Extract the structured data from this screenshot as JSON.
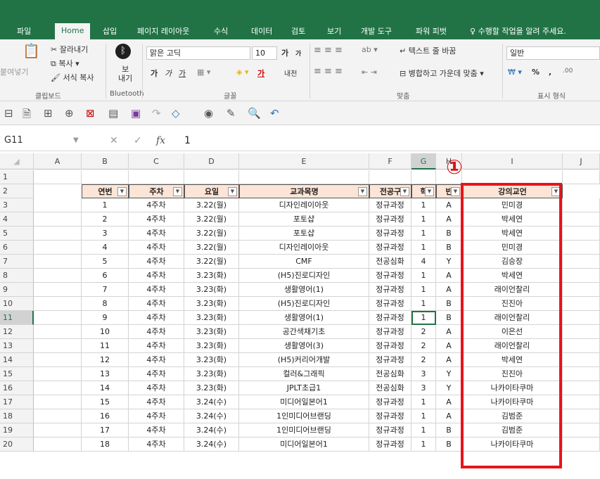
{
  "tabs": [
    "파일",
    "Home",
    "삽입",
    "페이지 레이아웃",
    "수식",
    "데이터",
    "검토",
    "보기",
    "개발 도구",
    "파워 피벗",
    "수행할 작업을 알려 주세요."
  ],
  "ribbon": {
    "clipboard": {
      "paste": "붙여넣기",
      "cut": "잘라내기",
      "copy": "복사 ▾",
      "format": "서식 복사",
      "group": "클립보드"
    },
    "bluetooth": {
      "send": "보\n내기",
      "group": "Bluetooth"
    },
    "font": {
      "name": "맑은 고딕",
      "size": "10",
      "grow": "가",
      "shrink": "가",
      "bold": "가",
      "italic": "가",
      "underline": "가",
      "fontcolor": "가",
      "phonetic": "내천",
      "group": "글꼴"
    },
    "align": {
      "wrap": "텍스트 줄 바꿈",
      "merge": "병합하고 가운데 맞춤 ▾",
      "group": "맞춤"
    },
    "number": {
      "format": "일반",
      "percent": "%",
      "comma": ",",
      "group": "표시 형식"
    }
  },
  "formula": {
    "namebox": "G11",
    "value": "1",
    "cancel": "✕",
    "enter": "✓",
    "fx": "fx"
  },
  "columns": [
    "A",
    "B",
    "C",
    "D",
    "E",
    "F",
    "G",
    "H",
    "I",
    "J"
  ],
  "row_numbers": [
    "1",
    "2",
    "3",
    "4",
    "5",
    "6",
    "7",
    "8",
    "9",
    "10",
    "11",
    "12",
    "13",
    "14",
    "15",
    "16",
    "17",
    "18",
    "19",
    "20"
  ],
  "headers": {
    "no": "연번",
    "week": "주차",
    "day": "요일",
    "course": "교과목명",
    "track": "전공구",
    "grade": "학",
    "class": "반",
    "teacher": "강의교언"
  },
  "rows": [
    [
      "1",
      "4주차",
      "3.22(월)",
      "디자인레이아웃",
      "정규과정",
      "1",
      "A",
      "민미경"
    ],
    [
      "2",
      "4주차",
      "3.22(월)",
      "포토샵",
      "정규과정",
      "1",
      "A",
      "박세연"
    ],
    [
      "3",
      "4주차",
      "3.22(월)",
      "포토샵",
      "정규과정",
      "1",
      "B",
      "박세연"
    ],
    [
      "4",
      "4주차",
      "3.22(월)",
      "디자인레이아웃",
      "정규과정",
      "1",
      "B",
      "민미경"
    ],
    [
      "5",
      "4주차",
      "3.22(월)",
      "CMF",
      "전공심화",
      "4",
      "Y",
      "김승장"
    ],
    [
      "6",
      "4주차",
      "3.23(화)",
      "(H5)진로디자인",
      "정규과정",
      "1",
      "A",
      "박세연"
    ],
    [
      "7",
      "4주차",
      "3.23(화)",
      "생활영어(1)",
      "정규과정",
      "1",
      "A",
      "래이언찰리"
    ],
    [
      "8",
      "4주차",
      "3.23(화)",
      "(H5)진로디자인",
      "정규과정",
      "1",
      "B",
      "진진아"
    ],
    [
      "9",
      "4주차",
      "3.23(화)",
      "생활영어(1)",
      "정규과정",
      "1",
      "B",
      "래이언찰리"
    ],
    [
      "10",
      "4주차",
      "3.23(화)",
      "공간색채기초",
      "정규과정",
      "2",
      "A",
      "이은선"
    ],
    [
      "11",
      "4주차",
      "3.23(화)",
      "생활영어(3)",
      "정규과정",
      "2",
      "A",
      "래이언찰리"
    ],
    [
      "12",
      "4주차",
      "3.23(화)",
      "(H5)커리어개발",
      "정규과정",
      "2",
      "A",
      "박세연"
    ],
    [
      "13",
      "4주차",
      "3.23(화)",
      "컬러&그래픽",
      "전공심화",
      "3",
      "Y",
      "진진아"
    ],
    [
      "14",
      "4주차",
      "3.23(화)",
      "JPLT초급1",
      "전공심화",
      "3",
      "Y",
      "나카이타쿠마"
    ],
    [
      "15",
      "4주차",
      "3.24(수)",
      "미디어일본어1",
      "정규과정",
      "1",
      "A",
      "나카이타쿠마"
    ],
    [
      "16",
      "4주차",
      "3.24(수)",
      "1인미디어브랜딩",
      "정규과정",
      "1",
      "A",
      "김범준"
    ],
    [
      "17",
      "4주차",
      "3.24(수)",
      "1인미디어브랜딩",
      "정규과정",
      "1",
      "B",
      "김범준"
    ],
    [
      "18",
      "4주차",
      "3.24(수)",
      "미디어일본어1",
      "정규과정",
      "1",
      "B",
      "나카이타쿠마"
    ]
  ],
  "annotation": {
    "marker": "①",
    "color": "#e8141b"
  },
  "colors": {
    "excel_green": "#217346",
    "header_fill": "#fce4d6"
  }
}
